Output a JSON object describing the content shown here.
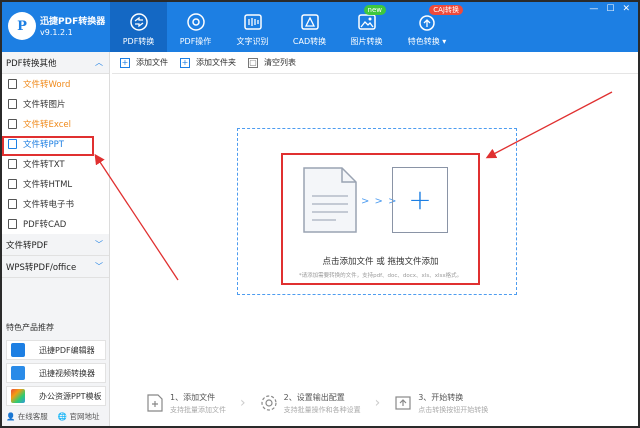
{
  "app": {
    "name": "迅捷PDF转换器",
    "version": "v9.1.2.1",
    "logo_letter": "P"
  },
  "nav": [
    {
      "label": "PDF转换",
      "icon": "convert-icon",
      "active": true
    },
    {
      "label": "PDF操作",
      "icon": "pdf-operate-icon"
    },
    {
      "label": "文字识别",
      "icon": "text-recognize-icon"
    },
    {
      "label": "CAD转换",
      "icon": "cad-icon"
    },
    {
      "label": "图片转换",
      "icon": "image-icon",
      "badge": "new"
    },
    {
      "label": "特色转换",
      "icon": "special-icon",
      "badge": "CAJ转换"
    }
  ],
  "sidebar": {
    "cat1": "PDF转换其他",
    "items": [
      {
        "label": "文件转Word"
      },
      {
        "label": "文件转图片"
      },
      {
        "label": "文件转Excel"
      },
      {
        "label": "文件转PPT"
      },
      {
        "label": "文件转TXT"
      },
      {
        "label": "文件转HTML"
      },
      {
        "label": "文件转电子书"
      },
      {
        "label": "PDF转CAD"
      }
    ],
    "cat2": "文件转PDF",
    "cat3": "WPS转PDF/office",
    "promo_title": "特色产品推荐",
    "promos": [
      {
        "label": "迅捷PDF编辑器"
      },
      {
        "label": "迅捷视频转换器"
      },
      {
        "label": "办公资源PPT模板"
      }
    ],
    "footer": {
      "service": "在线客服",
      "website": "官网地址"
    }
  },
  "toolbar": {
    "add_file": "添加文件",
    "add_folder": "添加文件夹",
    "clear": "清空列表"
  },
  "dropzone": {
    "main_text": "点击添加文件 或 拖拽文件添加",
    "hint": "*请添加需要转换的文件，支持pdf、doc、docx、xls、xlsx格式。",
    "arrows": "> > >",
    "plus": "+"
  },
  "steps": [
    {
      "title": "1、添加文件",
      "desc": "支持批量添加文件"
    },
    {
      "title": "2、设置输出配置",
      "desc": "支持批量操作和各种设置"
    },
    {
      "title": "3、开始转换",
      "desc": "点击转换按钮开始转换"
    }
  ],
  "window": {
    "ctrl1": "—",
    "ctrl2": "☐",
    "ctrl3": "✕"
  },
  "colors": {
    "brand": "#1d7fe3",
    "highlight": "#e03030",
    "orange": "#f08a1a"
  }
}
